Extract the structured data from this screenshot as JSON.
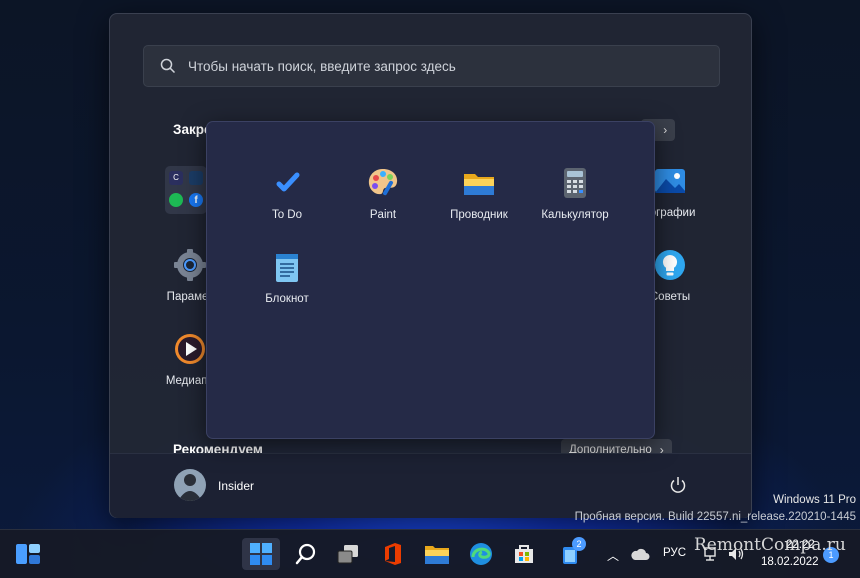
{
  "search": {
    "placeholder": "Чтобы начать поиск, введите запрос здесь"
  },
  "pinned": {
    "title": "Закре",
    "all_button": "я",
    "apps": [
      {
        "label": "Парамет",
        "icon": "settings-icon"
      },
      {
        "label": "Медиапл",
        "icon": "media-player-icon"
      },
      {
        "label": "тографии",
        "icon": "photos-icon"
      },
      {
        "label": "Советы",
        "icon": "tips-icon"
      }
    ]
  },
  "folder": {
    "apps": [
      {
        "label": "To Do",
        "icon": "todo-icon"
      },
      {
        "label": "Paint",
        "icon": "paint-icon"
      },
      {
        "label": "Проводник",
        "icon": "file-explorer-icon"
      },
      {
        "label": "Калькулятор",
        "icon": "calculator-icon"
      },
      {
        "label": "Блокнот",
        "icon": "notepad-icon"
      }
    ]
  },
  "recommended": {
    "title": "Рекомендуем",
    "more_button": "Дополнительно"
  },
  "user": {
    "name": "Insider"
  },
  "watermark": {
    "line1": "Windows 11 Pro",
    "line2": "Пробная версия. Build 22557.ni_release.220210-1445"
  },
  "taskbar": {
    "language": "РУС",
    "time": "22:22",
    "date": "18.02.2022",
    "notification_count": "2",
    "site_watermark": "RemontCompa.ru",
    "notifications_badge": "1"
  },
  "colors": {
    "accent": "#4c9bff",
    "popup_bg": "#252a47",
    "menu_bg": "#212634"
  }
}
